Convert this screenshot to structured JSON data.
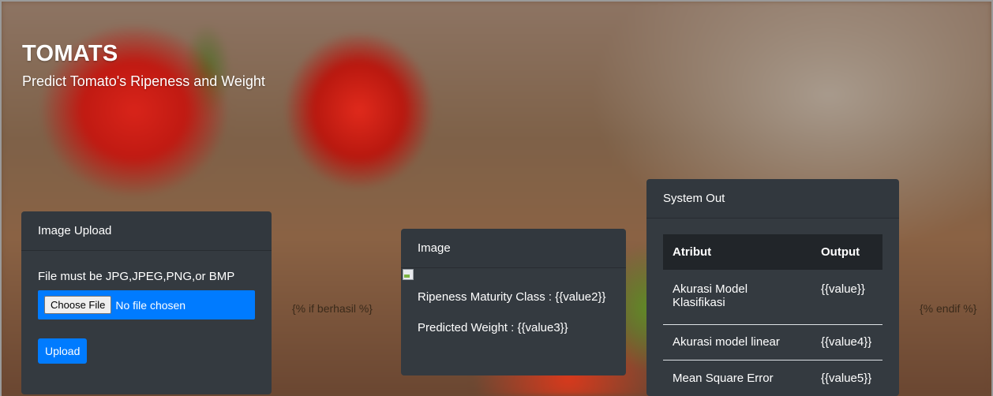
{
  "header": {
    "title": "TOMATS",
    "subtitle": "Predict Tomato's Ripeness and Weight"
  },
  "upload_card": {
    "title": "Image Upload",
    "note": "File must be JPG,JPEG,PNG,or BMP",
    "choose_file_label": "Choose File",
    "no_file_text": "No file chosen",
    "upload_label": "Upload"
  },
  "template_tags": {
    "if": "{% if berhasil %}",
    "endif": "{% endif %}"
  },
  "image_card": {
    "title": "Image",
    "ripeness": "Ripeness Maturity Class : {{value2}}",
    "weight": "Predicted Weight : {{value3}}"
  },
  "system_out": {
    "title": "System Out",
    "columns": [
      "Atribut",
      "Output"
    ],
    "rows": [
      [
        "Akurasi Model Klasifikasi",
        "{{value}}"
      ],
      [
        "Akurasi model linear",
        "{{value4}}"
      ],
      [
        "Mean Square Error",
        "{{value5}}"
      ]
    ]
  },
  "colors": {
    "card_bg": "#343a40",
    "table_header_bg": "#212529",
    "primary": "#007bff"
  }
}
